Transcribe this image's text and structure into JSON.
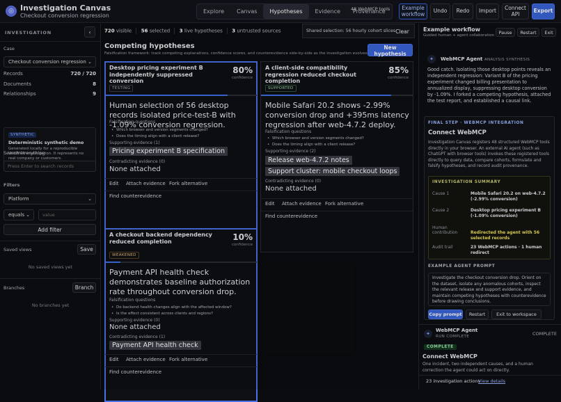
{
  "app": {
    "title": "Investigation Canvas",
    "subtitle": "Checkout conversion regression"
  },
  "nav": {
    "tabs": [
      "Explore",
      "Canvas",
      "Hypotheses",
      "Evidence",
      "Provenance"
    ],
    "active": "Hypotheses",
    "mcp_chip": "48 WebMCP tools"
  },
  "toolbar": {
    "example_workflow": "Example workflow",
    "undo": "Undo",
    "redo": "Redo",
    "import": "Import",
    "connect_api": "Connect API",
    "export": "Export"
  },
  "sidebar": {
    "investigation_label": "INVESTIGATION",
    "collapse_icon": "‹",
    "case_label": "Case",
    "case_value": "Checkout conversion regression",
    "metrics": [
      {
        "label": "Records",
        "value": "720 / 720"
      },
      {
        "label": "Documents",
        "value": "8"
      },
      {
        "label": "Relationships",
        "value": "9"
      }
    ],
    "demo": {
      "chip": "SYNTHETIC",
      "title": "Deterministic synthetic demo",
      "body": "Generated locally for a reproducible WebMCP investigation. It represents no real company or customers."
    },
    "search_label": "Search everything",
    "search_placeholder": "Press Enter to search records",
    "filters_label": "Filters",
    "filter_field": "Platform",
    "filter_op": "equals",
    "filter_value_placeholder": "value",
    "add_filter": "Add filter",
    "saved_views_label": "Saved views",
    "save_button": "Save",
    "saved_empty": "No saved views yet",
    "branches_label": "Branches",
    "branch_button": "Branch",
    "branches_empty": "No branches yet"
  },
  "stats": {
    "visible_count": "720",
    "visible_label": "visible",
    "selected_count": "56",
    "selected_label": "selected",
    "live_count": "3",
    "live_label": "live hypotheses",
    "untrusted_count": "3",
    "untrusted_label": "untrusted sources"
  },
  "selection": {
    "text": "Shared selection: 56 hourly cohort slices",
    "clear": "Clear"
  },
  "competing": {
    "title": "Competing hypotheses",
    "subtitle": "Falsification framework: track competing explanations, confidence scores, and counterevidence side-by-side as the investigation evolves.",
    "new_button": "New hypothesis"
  },
  "labels": {
    "confidence": "confidence",
    "falsification": "Falsification questions",
    "supporting": "Supporting evidence",
    "contradicting": "Contradicting evidence",
    "none": "None attached",
    "edit": "Edit",
    "attach": "Attach evidence",
    "fork": "Fork alternative",
    "find": "Find counterevidence"
  },
  "hypotheses": [
    {
      "title": "Desktop pricing experiment B independently suppressed conversion",
      "pct": "80%",
      "confidence": 0.8,
      "status": "TESTING",
      "summary": "Human selection of 56 desktop records isolated price-test-B with -1.09% conversion regression.",
      "questions": [
        "Which browser and version segments changed?",
        "Does the timing align with a client release?"
      ],
      "supporting_count": "(1)",
      "supporting": [
        "Pricing experiment B specification"
      ],
      "contradicting_count": "(0)"
    },
    {
      "title": "A client-side compatibility regression reduced checkout completion",
      "pct": "85%",
      "confidence": 0.85,
      "status": "SUPPORTED",
      "summary": "Mobile Safari 20.2 shows -2.99% conversion drop and +395ms latency regression after web-4.7.2 deploy.",
      "questions": [
        "Which browser and version segments changed?",
        "Does the timing align with a client release?"
      ],
      "supporting_count": "(2)",
      "supporting": [
        "Release web-4.7.2 notes",
        "Support cluster: mobile checkout loops"
      ],
      "contradicting_count": "(0)"
    },
    {
      "title": "A checkout backend dependency reduced completion",
      "pct": "10%",
      "confidence": 0.1,
      "status": "WEAKENED",
      "summary": "Payment API health check demonstrates baseline authorization rate throughout conversion drop.",
      "questions": [
        "Do backend health changes align with the affected window?",
        "Is the effect consistent across clients and regions?"
      ],
      "supporting_count": "(0)",
      "supporting": [],
      "contradicting_count": "(1)",
      "contradicting": [
        "Payment API health check"
      ]
    }
  ],
  "right": {
    "workflow_title": "Example workflow",
    "workflow_sub": "Guided human + agent collaboration",
    "pause": "Pause",
    "restart": "Restart",
    "exit": "Exit",
    "agent_name": "WebMCP Agent",
    "agent_tag": "ANALYSIS SYNTHESIS",
    "agent_text": "Good catch. Isolating those desktop points reveals an independent regression: Variant B of the pricing experiment changed billing presentation to annualized display, suppressing desktop conversion by -1.09%. I forked a competing hypothesis, attached the test report, and established a causal link.",
    "final_step": "FINAL STEP · WEBMCP INTEGRATION",
    "connect_title": "Connect WebMCP",
    "connect_body": "Investigation Canvas registers 48 structured WebMCP tools directly in your browser. An external AI agent (such as ChatGPT with browser tools) invokes these registered tools directly to query data, compare cohorts, formulate and falsify hypotheses, and record audit provenance.",
    "summary_title": "INVESTIGATION SUMMARY",
    "summary": [
      {
        "k": "Cause 1",
        "v": "Mobile Safari 20.2 on web-4.7.2 (-2.99% conversion)"
      },
      {
        "k": "Cause 2",
        "v": "Desktop pricing experiment B (-1.09% conversion)"
      },
      {
        "k": "Human contribution",
        "v": "Redirected the agent with 56 selected records"
      },
      {
        "k": "Audit trail",
        "v": "23 WebMCP actions · 1 human redirect"
      }
    ],
    "prompt_title": "EXAMPLE AGENT PROMPT",
    "prompt": "Investigate the checkout conversion drop. Orient on the dataset, isolate any anomalous cohorts, inspect the relevant release and support evidence, and maintain competing hypotheses with counterevidence before drawing conclusions.",
    "copy_prompt": "Copy prompt",
    "restart2": "Restart",
    "exit_ws": "Exit to workspace",
    "run_agent": "WebMCP Agent",
    "run_status": "RUN COMPLETE",
    "complete_label": "COMPLETE",
    "complete_badge": "COMPLETE",
    "connect2": "Connect WebMCP",
    "connect2_body": "One incident, two independent causes, and a human correction the agent could act on directly.",
    "actions": "23 investigation actions",
    "view_details": "View details"
  },
  "colors": {
    "accent": "#3a63d8",
    "highlight": "#f0e05a",
    "panel": "#0d0e12"
  }
}
